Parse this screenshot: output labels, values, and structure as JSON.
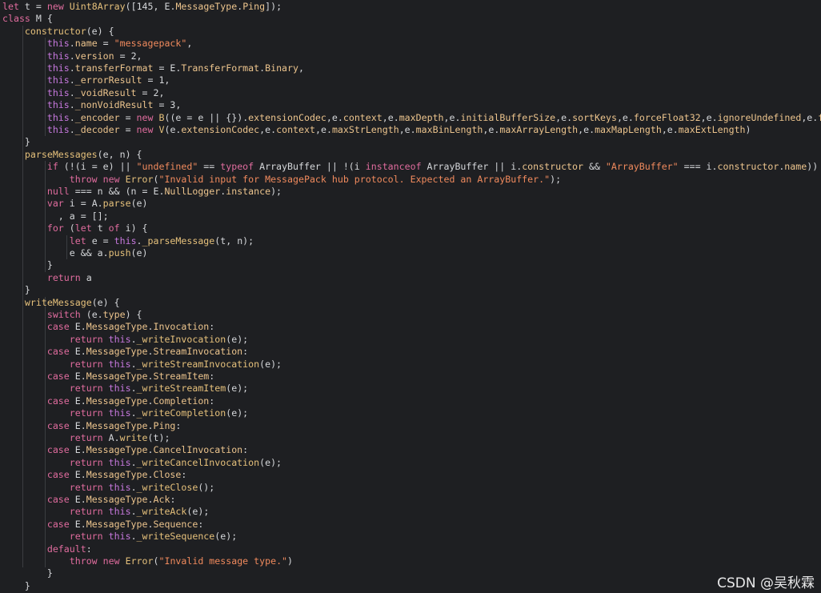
{
  "watermark": "CSDN @吴秋霖",
  "code_lines": [
    [
      {
        "c": "k",
        "t": "let"
      },
      {
        "t": " t = "
      },
      {
        "c": "k",
        "t": "new"
      },
      {
        "t": " "
      },
      {
        "c": "f",
        "t": "Uint8Array"
      },
      {
        "t": "([145, E."
      },
      {
        "c": "p",
        "t": "MessageType"
      },
      {
        "t": "."
      },
      {
        "c": "p",
        "t": "Ping"
      },
      {
        "t": "]);"
      }
    ],
    [
      {
        "c": "k",
        "t": "class"
      },
      {
        "t": " M {"
      }
    ],
    [
      {
        "t": "    "
      },
      {
        "c": "f",
        "t": "constructor"
      },
      {
        "t": "(e) {"
      }
    ],
    [
      {
        "t": "        "
      },
      {
        "c": "t",
        "t": "this"
      },
      {
        "t": "."
      },
      {
        "c": "p",
        "t": "name"
      },
      {
        "t": " = "
      },
      {
        "c": "s",
        "t": "\"messagepack\""
      },
      {
        "t": ","
      }
    ],
    [
      {
        "t": "        "
      },
      {
        "c": "t",
        "t": "this"
      },
      {
        "t": "."
      },
      {
        "c": "p",
        "t": "version"
      },
      {
        "t": " = 2,"
      }
    ],
    [
      {
        "t": "        "
      },
      {
        "c": "t",
        "t": "this"
      },
      {
        "t": "."
      },
      {
        "c": "p",
        "t": "transferFormat"
      },
      {
        "t": " = E."
      },
      {
        "c": "p",
        "t": "TransferFormat"
      },
      {
        "t": "."
      },
      {
        "c": "p",
        "t": "Binary"
      },
      {
        "t": ","
      }
    ],
    [
      {
        "t": "        "
      },
      {
        "c": "t",
        "t": "this"
      },
      {
        "t": "."
      },
      {
        "c": "p",
        "t": "_errorResult"
      },
      {
        "t": " = 1,"
      }
    ],
    [
      {
        "t": "        "
      },
      {
        "c": "t",
        "t": "this"
      },
      {
        "t": "."
      },
      {
        "c": "p",
        "t": "_voidResult"
      },
      {
        "t": " = 2,"
      }
    ],
    [
      {
        "t": "        "
      },
      {
        "c": "t",
        "t": "this"
      },
      {
        "t": "."
      },
      {
        "c": "p",
        "t": "_nonVoidResult"
      },
      {
        "t": " = 3,"
      }
    ],
    [
      {
        "t": "        "
      },
      {
        "c": "t",
        "t": "this"
      },
      {
        "t": "."
      },
      {
        "c": "p",
        "t": "_encoder"
      },
      {
        "t": " = "
      },
      {
        "c": "k",
        "t": "new"
      },
      {
        "t": " "
      },
      {
        "c": "f",
        "t": "B"
      },
      {
        "t": "((e = e || {})."
      },
      {
        "c": "p",
        "t": "extensionCodec"
      },
      {
        "t": ",e."
      },
      {
        "c": "p",
        "t": "context"
      },
      {
        "t": ",e."
      },
      {
        "c": "p",
        "t": "maxDepth"
      },
      {
        "t": ",e."
      },
      {
        "c": "p",
        "t": "initialBufferSize"
      },
      {
        "t": ",e."
      },
      {
        "c": "p",
        "t": "sortKeys"
      },
      {
        "t": ",e."
      },
      {
        "c": "p",
        "t": "forceFloat32"
      },
      {
        "t": ",e."
      },
      {
        "c": "p",
        "t": "ignoreUndefined"
      },
      {
        "t": ",e."
      },
      {
        "c": "p",
        "t": "forceInte"
      }
    ],
    [
      {
        "t": "        "
      },
      {
        "c": "t",
        "t": "this"
      },
      {
        "t": "."
      },
      {
        "c": "p",
        "t": "_decoder"
      },
      {
        "t": " = "
      },
      {
        "c": "k",
        "t": "new"
      },
      {
        "t": " "
      },
      {
        "c": "f",
        "t": "V"
      },
      {
        "t": "(e."
      },
      {
        "c": "p",
        "t": "extensionCodec"
      },
      {
        "t": ",e."
      },
      {
        "c": "p",
        "t": "context"
      },
      {
        "t": ",e."
      },
      {
        "c": "p",
        "t": "maxStrLength"
      },
      {
        "t": ",e."
      },
      {
        "c": "p",
        "t": "maxBinLength"
      },
      {
        "t": ",e."
      },
      {
        "c": "p",
        "t": "maxArrayLength"
      },
      {
        "t": ",e."
      },
      {
        "c": "p",
        "t": "maxMapLength"
      },
      {
        "t": ",e."
      },
      {
        "c": "p",
        "t": "maxExtLength"
      },
      {
        "t": ")"
      }
    ],
    [
      {
        "t": "    }"
      }
    ],
    [
      {
        "t": "    "
      },
      {
        "c": "f",
        "t": "parseMessages"
      },
      {
        "t": "(e, n) {"
      }
    ],
    [
      {
        "t": "        "
      },
      {
        "c": "k",
        "t": "if"
      },
      {
        "t": " (!(i = e) || "
      },
      {
        "c": "s",
        "t": "\"undefined\""
      },
      {
        "t": " == "
      },
      {
        "c": "k",
        "t": "typeof"
      },
      {
        "t": " ArrayBuffer || !(i "
      },
      {
        "c": "k",
        "t": "instanceof"
      },
      {
        "t": " ArrayBuffer || i."
      },
      {
        "c": "p",
        "t": "constructor"
      },
      {
        "t": " && "
      },
      {
        "c": "s",
        "t": "\"ArrayBuffer\""
      },
      {
        "t": " === i."
      },
      {
        "c": "p",
        "t": "constructor"
      },
      {
        "t": "."
      },
      {
        "c": "p",
        "t": "name"
      },
      {
        "t": "))"
      }
    ],
    [
      {
        "t": "            "
      },
      {
        "c": "k",
        "t": "throw"
      },
      {
        "t": " "
      },
      {
        "c": "k",
        "t": "new"
      },
      {
        "t": " "
      },
      {
        "c": "f",
        "t": "Error"
      },
      {
        "t": "("
      },
      {
        "c": "s",
        "t": "\"Invalid input for MessagePack hub protocol. Expected an ArrayBuffer.\""
      },
      {
        "t": ");"
      }
    ],
    [
      {
        "t": "        "
      },
      {
        "c": "k",
        "t": "null"
      },
      {
        "t": " === n && (n = E."
      },
      {
        "c": "p",
        "t": "NullLogger"
      },
      {
        "t": "."
      },
      {
        "c": "p",
        "t": "instance"
      },
      {
        "t": ");"
      }
    ],
    [
      {
        "t": "        "
      },
      {
        "c": "k",
        "t": "var"
      },
      {
        "t": " i = A."
      },
      {
        "c": "f",
        "t": "parse"
      },
      {
        "t": "(e)"
      }
    ],
    [
      {
        "t": "          , a = [];"
      }
    ],
    [
      {
        "t": "        "
      },
      {
        "c": "k",
        "t": "for"
      },
      {
        "t": " ("
      },
      {
        "c": "k",
        "t": "let"
      },
      {
        "t": " t "
      },
      {
        "c": "k",
        "t": "of"
      },
      {
        "t": " i) {"
      }
    ],
    [
      {
        "t": "            "
      },
      {
        "c": "k",
        "t": "let"
      },
      {
        "t": " e = "
      },
      {
        "c": "t",
        "t": "this"
      },
      {
        "t": "."
      },
      {
        "c": "f",
        "t": "_parseMessage"
      },
      {
        "t": "(t, n);"
      }
    ],
    [
      {
        "t": "            e && a."
      },
      {
        "c": "f",
        "t": "push"
      },
      {
        "t": "(e)"
      }
    ],
    [
      {
        "t": "        }"
      }
    ],
    [
      {
        "t": "        "
      },
      {
        "c": "k",
        "t": "return"
      },
      {
        "t": " a"
      }
    ],
    [
      {
        "t": "    }"
      }
    ],
    [
      {
        "t": "    "
      },
      {
        "c": "f",
        "t": "writeMessage"
      },
      {
        "t": "(e) {"
      }
    ],
    [
      {
        "t": "        "
      },
      {
        "c": "k",
        "t": "switch"
      },
      {
        "t": " (e."
      },
      {
        "c": "p",
        "t": "type"
      },
      {
        "t": ") {"
      }
    ],
    [
      {
        "t": "        "
      },
      {
        "c": "k",
        "t": "case"
      },
      {
        "t": " E."
      },
      {
        "c": "p",
        "t": "MessageType"
      },
      {
        "t": "."
      },
      {
        "c": "p",
        "t": "Invocation"
      },
      {
        "t": ":"
      }
    ],
    [
      {
        "t": "            "
      },
      {
        "c": "k",
        "t": "return"
      },
      {
        "t": " "
      },
      {
        "c": "t",
        "t": "this"
      },
      {
        "t": "."
      },
      {
        "c": "f",
        "t": "_writeInvocation"
      },
      {
        "t": "(e);"
      }
    ],
    [
      {
        "t": "        "
      },
      {
        "c": "k",
        "t": "case"
      },
      {
        "t": " E."
      },
      {
        "c": "p",
        "t": "MessageType"
      },
      {
        "t": "."
      },
      {
        "c": "p",
        "t": "StreamInvocation"
      },
      {
        "t": ":"
      }
    ],
    [
      {
        "t": "            "
      },
      {
        "c": "k",
        "t": "return"
      },
      {
        "t": " "
      },
      {
        "c": "t",
        "t": "this"
      },
      {
        "t": "."
      },
      {
        "c": "f",
        "t": "_writeStreamInvocation"
      },
      {
        "t": "(e);"
      }
    ],
    [
      {
        "t": "        "
      },
      {
        "c": "k",
        "t": "case"
      },
      {
        "t": " E."
      },
      {
        "c": "p",
        "t": "MessageType"
      },
      {
        "t": "."
      },
      {
        "c": "p",
        "t": "StreamItem"
      },
      {
        "t": ":"
      }
    ],
    [
      {
        "t": "            "
      },
      {
        "c": "k",
        "t": "return"
      },
      {
        "t": " "
      },
      {
        "c": "t",
        "t": "this"
      },
      {
        "t": "."
      },
      {
        "c": "f",
        "t": "_writeStreamItem"
      },
      {
        "t": "(e);"
      }
    ],
    [
      {
        "t": "        "
      },
      {
        "c": "k",
        "t": "case"
      },
      {
        "t": " E."
      },
      {
        "c": "p",
        "t": "MessageType"
      },
      {
        "t": "."
      },
      {
        "c": "p",
        "t": "Completion"
      },
      {
        "t": ":"
      }
    ],
    [
      {
        "t": "            "
      },
      {
        "c": "k",
        "t": "return"
      },
      {
        "t": " "
      },
      {
        "c": "t",
        "t": "this"
      },
      {
        "t": "."
      },
      {
        "c": "f",
        "t": "_writeCompletion"
      },
      {
        "t": "(e);"
      }
    ],
    [
      {
        "t": "        "
      },
      {
        "c": "k",
        "t": "case"
      },
      {
        "t": " E."
      },
      {
        "c": "p",
        "t": "MessageType"
      },
      {
        "t": "."
      },
      {
        "c": "p",
        "t": "Ping"
      },
      {
        "t": ":"
      }
    ],
    [
      {
        "t": "            "
      },
      {
        "c": "k",
        "t": "return"
      },
      {
        "t": " A."
      },
      {
        "c": "f",
        "t": "write"
      },
      {
        "t": "(t);"
      }
    ],
    [
      {
        "t": "        "
      },
      {
        "c": "k",
        "t": "case"
      },
      {
        "t": " E."
      },
      {
        "c": "p",
        "t": "MessageType"
      },
      {
        "t": "."
      },
      {
        "c": "p",
        "t": "CancelInvocation"
      },
      {
        "t": ":"
      }
    ],
    [
      {
        "t": "            "
      },
      {
        "c": "k",
        "t": "return"
      },
      {
        "t": " "
      },
      {
        "c": "t",
        "t": "this"
      },
      {
        "t": "."
      },
      {
        "c": "f",
        "t": "_writeCancelInvocation"
      },
      {
        "t": "(e);"
      }
    ],
    [
      {
        "t": "        "
      },
      {
        "c": "k",
        "t": "case"
      },
      {
        "t": " E."
      },
      {
        "c": "p",
        "t": "MessageType"
      },
      {
        "t": "."
      },
      {
        "c": "p",
        "t": "Close"
      },
      {
        "t": ":"
      }
    ],
    [
      {
        "t": "            "
      },
      {
        "c": "k",
        "t": "return"
      },
      {
        "t": " "
      },
      {
        "c": "t",
        "t": "this"
      },
      {
        "t": "."
      },
      {
        "c": "f",
        "t": "_writeClose"
      },
      {
        "t": "();"
      }
    ],
    [
      {
        "t": "        "
      },
      {
        "c": "k",
        "t": "case"
      },
      {
        "t": " E."
      },
      {
        "c": "p",
        "t": "MessageType"
      },
      {
        "t": "."
      },
      {
        "c": "p",
        "t": "Ack"
      },
      {
        "t": ":"
      }
    ],
    [
      {
        "t": "            "
      },
      {
        "c": "k",
        "t": "return"
      },
      {
        "t": " "
      },
      {
        "c": "t",
        "t": "this"
      },
      {
        "t": "."
      },
      {
        "c": "f",
        "t": "_writeAck"
      },
      {
        "t": "(e);"
      }
    ],
    [
      {
        "t": "        "
      },
      {
        "c": "k",
        "t": "case"
      },
      {
        "t": " E."
      },
      {
        "c": "p",
        "t": "MessageType"
      },
      {
        "t": "."
      },
      {
        "c": "p",
        "t": "Sequence"
      },
      {
        "t": ":"
      }
    ],
    [
      {
        "t": "            "
      },
      {
        "c": "k",
        "t": "return"
      },
      {
        "t": " "
      },
      {
        "c": "t",
        "t": "this"
      },
      {
        "t": "."
      },
      {
        "c": "f",
        "t": "_writeSequence"
      },
      {
        "t": "(e);"
      }
    ],
    [
      {
        "t": "        "
      },
      {
        "c": "k",
        "t": "default"
      },
      {
        "t": ":"
      }
    ],
    [
      {
        "t": "            "
      },
      {
        "c": "k",
        "t": "throw"
      },
      {
        "t": " "
      },
      {
        "c": "k",
        "t": "new"
      },
      {
        "t": " "
      },
      {
        "c": "f",
        "t": "Error"
      },
      {
        "t": "("
      },
      {
        "c": "s",
        "t": "\"Invalid message type.\""
      },
      {
        "t": ")"
      }
    ],
    [
      {
        "t": "        }"
      }
    ],
    [
      {
        "t": "    }"
      }
    ]
  ]
}
